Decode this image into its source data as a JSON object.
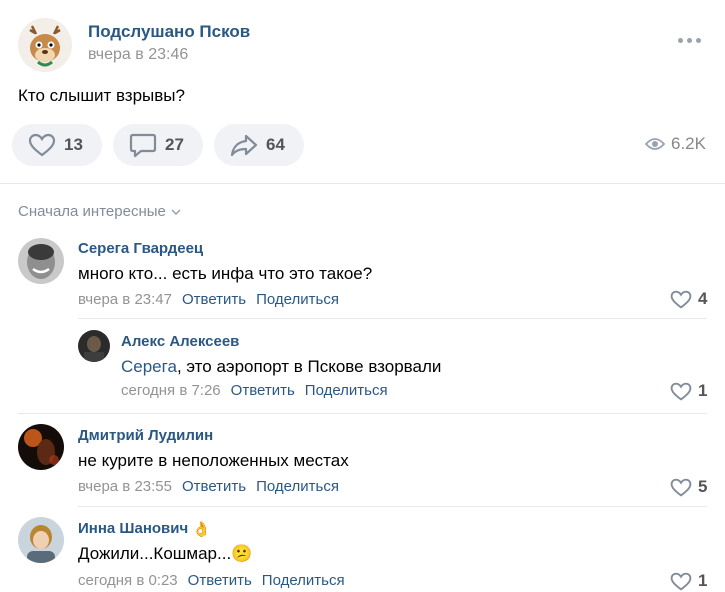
{
  "post": {
    "group_name": "Подслушано Псков",
    "time": "вчера в 23:46",
    "text": "Кто слышит взрывы?",
    "likes": "13",
    "comments": "27",
    "shares": "64",
    "views": "6.2K"
  },
  "sort_label": "Сначала интересные",
  "comments": [
    {
      "author": "Серега Гвардеец",
      "text": "много кто... есть инфа что это такое?",
      "time": "вчера в 23:47",
      "reply": "Ответить",
      "share": "Поделиться",
      "likes": "4"
    },
    {
      "author": "Алекс Алексеев",
      "mention": "Серега",
      "text": ", это аэропорт в Пскове взорвали",
      "time": "сегодня в 7:26",
      "reply": "Ответить",
      "share": "Поделиться",
      "likes": "1"
    },
    {
      "author": "Дмитрий Лудилин",
      "text": "не курите в неположенных местах",
      "time": "вчера в 23:55",
      "reply": "Ответить",
      "share": "Поделиться",
      "likes": "5"
    },
    {
      "author": "Инна Шанович",
      "author_emoji": "👌",
      "text": "Дожили...Кошмар...",
      "text_emoji": "😕",
      "time": "сегодня в 0:23",
      "reply": "Ответить",
      "share": "Поделиться",
      "likes": "1"
    }
  ],
  "colors": {
    "link": "#2a5885",
    "muted": "#939393",
    "button_bg": "#f0f2f5"
  }
}
